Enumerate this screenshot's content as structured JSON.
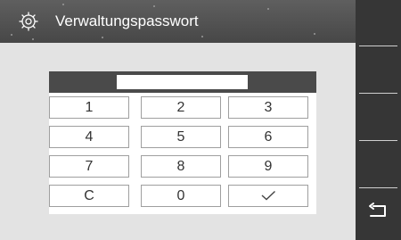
{
  "header": {
    "title": "Verwaltungspasswort",
    "icon": "gear-icon",
    "background": "#4f4f4f"
  },
  "password": {
    "value": "",
    "placeholder": ""
  },
  "keypad": {
    "keys": [
      "1",
      "2",
      "3",
      "4",
      "5",
      "6",
      "7",
      "8",
      "9",
      "C",
      "0"
    ],
    "confirm_icon": "checkmark-icon"
  },
  "side_panel": {
    "back_icon": "return-arrow-icon",
    "background": "#363636"
  }
}
